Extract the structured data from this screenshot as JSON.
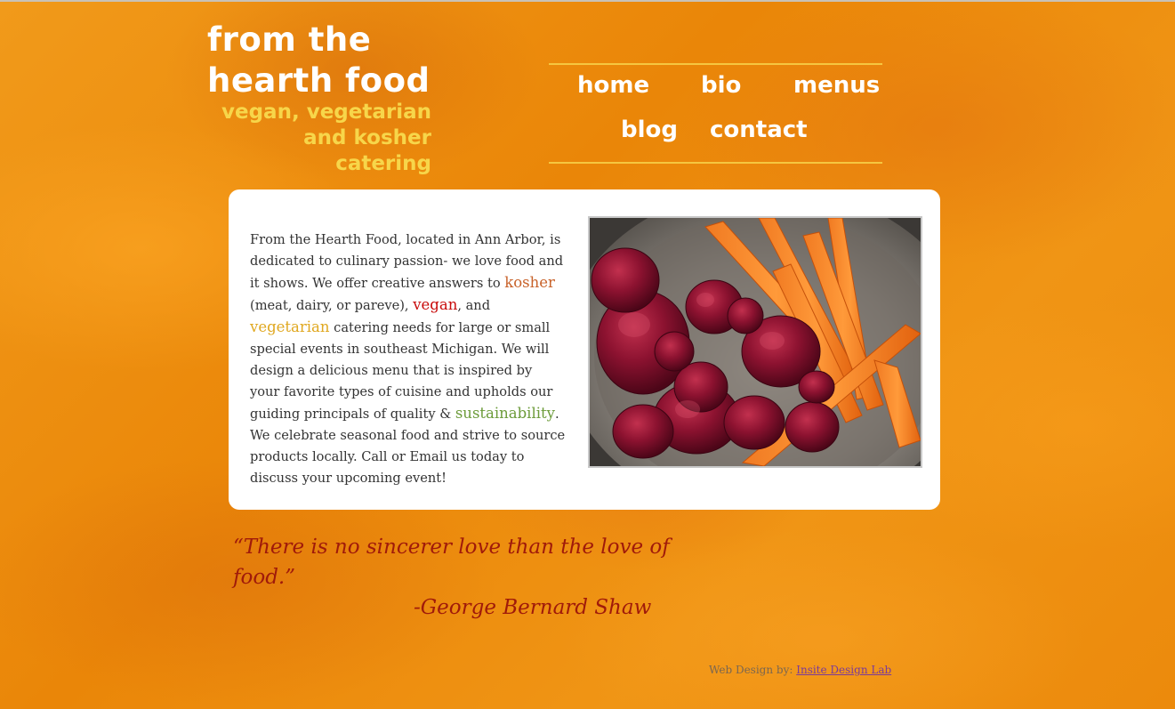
{
  "site": {
    "title_line1": "From the",
    "title_line2": "Hearth Food",
    "tagline": "vegan, vegetarian\nand kosher\ncatering"
  },
  "nav": {
    "items": [
      {
        "label": "home"
      },
      {
        "label": "bio"
      },
      {
        "label": "menus"
      },
      {
        "label": "blog"
      },
      {
        "label": "contact"
      }
    ]
  },
  "intro": {
    "part1": "From the Hearth Food, located in Ann Arbor, is dedicated to culinary passion- we love food and it shows. We offer creative answers to ",
    "kosher": "kosher",
    "part2": " (meat, dairy, or pareve), ",
    "vegan": "vegan",
    "part3": ", and ",
    "vegetarian": "vegetarian",
    "part4": " catering needs for large or small special events in southeast Michigan. We will design a delicious menu that is inspired by your favorite types of cuisine and upholds our guiding principals of quality & ",
    "sustainability": "sustainability",
    "part5": ". We celebrate seasonal food and strive to source products locally. Call or Email us today to discuss your upcoming event!"
  },
  "quote": {
    "text": "“There is no sincerer love than the love of food.”",
    "author": "-George Bernard Shaw"
  },
  "footer": {
    "credit_prefix": "Web Design by: ",
    "credit_link": "Insite Design Lab"
  },
  "colors": {
    "background": "#ee8f0c",
    "nav_rule": "#f5c640",
    "tagline": "#f7d64a",
    "kosher": "#c8622a",
    "vegan": "#c80a0a",
    "vegetarian": "#e0a820",
    "sustainability": "#6c9b3a",
    "quote": "#a01a0a"
  }
}
